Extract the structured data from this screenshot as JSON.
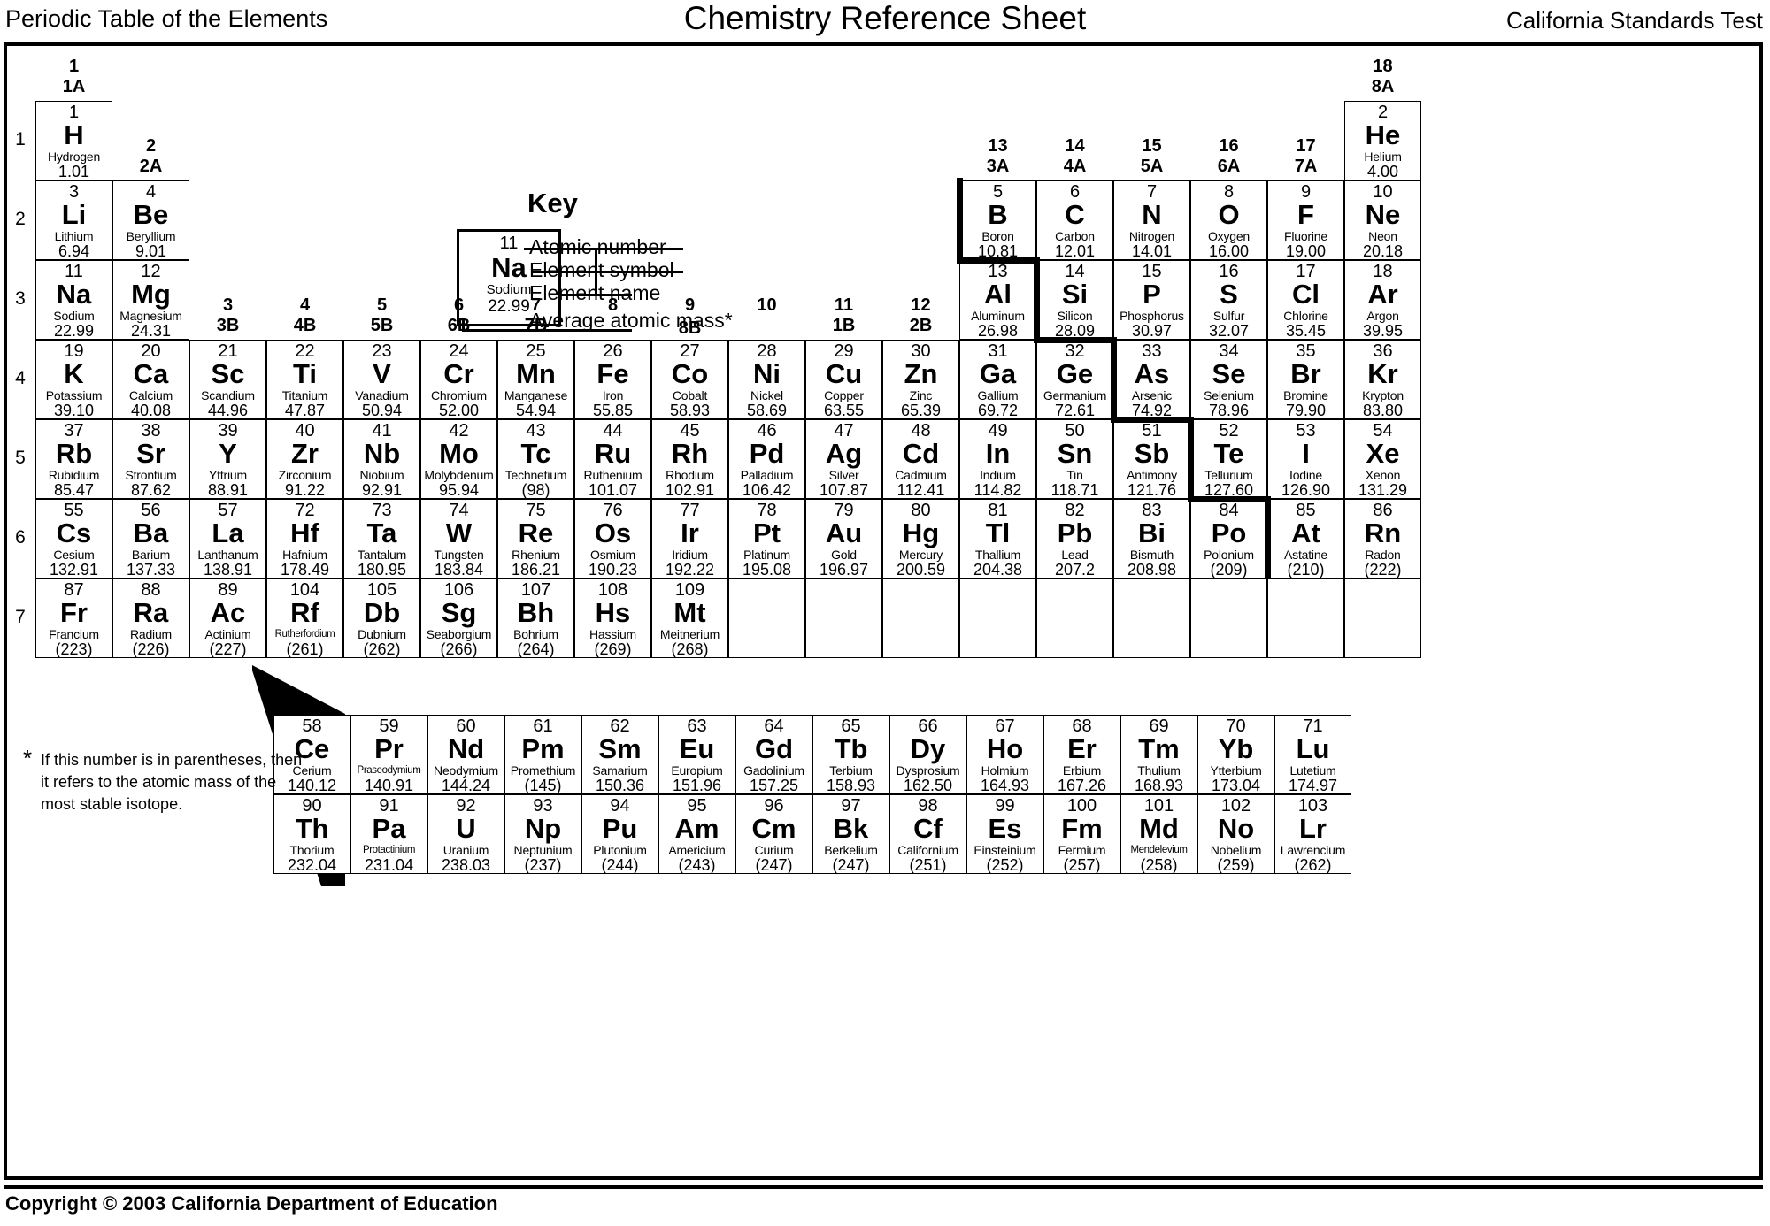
{
  "header": {
    "left": "Periodic Table of the Elements",
    "center": "Chemistry Reference Sheet",
    "right": "California Standards Test"
  },
  "key": {
    "title": "Key",
    "sample": {
      "number": "11",
      "symbol": "Na",
      "name": "Sodium",
      "mass": "22.99"
    },
    "labels": {
      "atomic_number": "Atomic number",
      "element_symbol": "Element symbol",
      "element_name": "Element name",
      "average_atomic_mass": "Average atomic mass*"
    }
  },
  "footnote": {
    "star": "*",
    "line1": "If this number is in parentheses, then",
    "line2": "it refers to the atomic mass of the",
    "line3": "most stable isotope."
  },
  "copyright": "Copyright © 2003 California Department of Education",
  "periods": [
    "1",
    "2",
    "3",
    "4",
    "5",
    "6",
    "7"
  ],
  "groups": [
    {
      "col": 1,
      "num": "1",
      "roman": "1A"
    },
    {
      "col": 2,
      "num": "2",
      "roman": "2A"
    },
    {
      "col": 3,
      "num": "3",
      "roman": "3B"
    },
    {
      "col": 4,
      "num": "4",
      "roman": "4B"
    },
    {
      "col": 5,
      "num": "5",
      "roman": "5B"
    },
    {
      "col": 6,
      "num": "6",
      "roman": "6B"
    },
    {
      "col": 7,
      "num": "7",
      "roman": "7B"
    },
    {
      "col": 8,
      "num": "8",
      "roman": ""
    },
    {
      "col": 9,
      "num": "9",
      "roman": ""
    },
    {
      "col": 10,
      "num": "10",
      "roman": ""
    },
    {
      "col": 11,
      "num": "11",
      "roman": "1B"
    },
    {
      "col": 12,
      "num": "12",
      "roman": "2B"
    },
    {
      "col": 13,
      "num": "13",
      "roman": "3A"
    },
    {
      "col": 14,
      "num": "14",
      "roman": "4A"
    },
    {
      "col": 15,
      "num": "15",
      "roman": "5A"
    },
    {
      "col": 16,
      "num": "16",
      "roman": "6A"
    },
    {
      "col": 17,
      "num": "17",
      "roman": "7A"
    },
    {
      "col": 18,
      "num": "18",
      "roman": "8A"
    }
  ],
  "group8b_label": "8B",
  "elements": [
    {
      "z": "1",
      "sym": "H",
      "name": "Hydrogen",
      "mass": "1.01",
      "col": 1,
      "row": 1
    },
    {
      "z": "2",
      "sym": "He",
      "name": "Helium",
      "mass": "4.00",
      "col": 18,
      "row": 1
    },
    {
      "z": "3",
      "sym": "Li",
      "name": "Lithium",
      "mass": "6.94",
      "col": 1,
      "row": 2
    },
    {
      "z": "4",
      "sym": "Be",
      "name": "Beryllium",
      "mass": "9.01",
      "col": 2,
      "row": 2
    },
    {
      "z": "5",
      "sym": "B",
      "name": "Boron",
      "mass": "10.81",
      "col": 13,
      "row": 2
    },
    {
      "z": "6",
      "sym": "C",
      "name": "Carbon",
      "mass": "12.01",
      "col": 14,
      "row": 2
    },
    {
      "z": "7",
      "sym": "N",
      "name": "Nitrogen",
      "mass": "14.01",
      "col": 15,
      "row": 2
    },
    {
      "z": "8",
      "sym": "O",
      "name": "Oxygen",
      "mass": "16.00",
      "col": 16,
      "row": 2
    },
    {
      "z": "9",
      "sym": "F",
      "name": "Fluorine",
      "mass": "19.00",
      "col": 17,
      "row": 2
    },
    {
      "z": "10",
      "sym": "Ne",
      "name": "Neon",
      "mass": "20.18",
      "col": 18,
      "row": 2
    },
    {
      "z": "11",
      "sym": "Na",
      "name": "Sodium",
      "mass": "22.99",
      "col": 1,
      "row": 3
    },
    {
      "z": "12",
      "sym": "Mg",
      "name": "Magnesium",
      "mass": "24.31",
      "col": 2,
      "row": 3
    },
    {
      "z": "13",
      "sym": "Al",
      "name": "Aluminum",
      "mass": "26.98",
      "col": 13,
      "row": 3
    },
    {
      "z": "14",
      "sym": "Si",
      "name": "Silicon",
      "mass": "28.09",
      "col": 14,
      "row": 3
    },
    {
      "z": "15",
      "sym": "P",
      "name": "Phosphorus",
      "mass": "30.97",
      "col": 15,
      "row": 3
    },
    {
      "z": "16",
      "sym": "S",
      "name": "Sulfur",
      "mass": "32.07",
      "col": 16,
      "row": 3
    },
    {
      "z": "17",
      "sym": "Cl",
      "name": "Chlorine",
      "mass": "35.45",
      "col": 17,
      "row": 3
    },
    {
      "z": "18",
      "sym": "Ar",
      "name": "Argon",
      "mass": "39.95",
      "col": 18,
      "row": 3
    },
    {
      "z": "19",
      "sym": "K",
      "name": "Potassium",
      "mass": "39.10",
      "col": 1,
      "row": 4
    },
    {
      "z": "20",
      "sym": "Ca",
      "name": "Calcium",
      "mass": "40.08",
      "col": 2,
      "row": 4
    },
    {
      "z": "21",
      "sym": "Sc",
      "name": "Scandium",
      "mass": "44.96",
      "col": 3,
      "row": 4
    },
    {
      "z": "22",
      "sym": "Ti",
      "name": "Titanium",
      "mass": "47.87",
      "col": 4,
      "row": 4
    },
    {
      "z": "23",
      "sym": "V",
      "name": "Vanadium",
      "mass": "50.94",
      "col": 5,
      "row": 4
    },
    {
      "z": "24",
      "sym": "Cr",
      "name": "Chromium",
      "mass": "52.00",
      "col": 6,
      "row": 4
    },
    {
      "z": "25",
      "sym": "Mn",
      "name": "Manganese",
      "mass": "54.94",
      "col": 7,
      "row": 4
    },
    {
      "z": "26",
      "sym": "Fe",
      "name": "Iron",
      "mass": "55.85",
      "col": 8,
      "row": 4
    },
    {
      "z": "27",
      "sym": "Co",
      "name": "Cobalt",
      "mass": "58.93",
      "col": 9,
      "row": 4
    },
    {
      "z": "28",
      "sym": "Ni",
      "name": "Nickel",
      "mass": "58.69",
      "col": 10,
      "row": 4
    },
    {
      "z": "29",
      "sym": "Cu",
      "name": "Copper",
      "mass": "63.55",
      "col": 11,
      "row": 4
    },
    {
      "z": "30",
      "sym": "Zn",
      "name": "Zinc",
      "mass": "65.39",
      "col": 12,
      "row": 4
    },
    {
      "z": "31",
      "sym": "Ga",
      "name": "Gallium",
      "mass": "69.72",
      "col": 13,
      "row": 4
    },
    {
      "z": "32",
      "sym": "Ge",
      "name": "Germanium",
      "mass": "72.61",
      "col": 14,
      "row": 4
    },
    {
      "z": "33",
      "sym": "As",
      "name": "Arsenic",
      "mass": "74.92",
      "col": 15,
      "row": 4
    },
    {
      "z": "34",
      "sym": "Se",
      "name": "Selenium",
      "mass": "78.96",
      "col": 16,
      "row": 4
    },
    {
      "z": "35",
      "sym": "Br",
      "name": "Bromine",
      "mass": "79.90",
      "col": 17,
      "row": 4
    },
    {
      "z": "36",
      "sym": "Kr",
      "name": "Krypton",
      "mass": "83.80",
      "col": 18,
      "row": 4
    },
    {
      "z": "37",
      "sym": "Rb",
      "name": "Rubidium",
      "mass": "85.47",
      "col": 1,
      "row": 5
    },
    {
      "z": "38",
      "sym": "Sr",
      "name": "Strontium",
      "mass": "87.62",
      "col": 2,
      "row": 5
    },
    {
      "z": "39",
      "sym": "Y",
      "name": "Yttrium",
      "mass": "88.91",
      "col": 3,
      "row": 5
    },
    {
      "z": "40",
      "sym": "Zr",
      "name": "Zirconium",
      "mass": "91.22",
      "col": 4,
      "row": 5
    },
    {
      "z": "41",
      "sym": "Nb",
      "name": "Niobium",
      "mass": "92.91",
      "col": 5,
      "row": 5
    },
    {
      "z": "42",
      "sym": "Mo",
      "name": "Molybdenum",
      "mass": "95.94",
      "col": 6,
      "row": 5
    },
    {
      "z": "43",
      "sym": "Tc",
      "name": "Technetium",
      "mass": "(98)",
      "col": 7,
      "row": 5
    },
    {
      "z": "44",
      "sym": "Ru",
      "name": "Ruthenium",
      "mass": "101.07",
      "col": 8,
      "row": 5
    },
    {
      "z": "45",
      "sym": "Rh",
      "name": "Rhodium",
      "mass": "102.91",
      "col": 9,
      "row": 5
    },
    {
      "z": "46",
      "sym": "Pd",
      "name": "Palladium",
      "mass": "106.42",
      "col": 10,
      "row": 5
    },
    {
      "z": "47",
      "sym": "Ag",
      "name": "Silver",
      "mass": "107.87",
      "col": 11,
      "row": 5
    },
    {
      "z": "48",
      "sym": "Cd",
      "name": "Cadmium",
      "mass": "112.41",
      "col": 12,
      "row": 5
    },
    {
      "z": "49",
      "sym": "In",
      "name": "Indium",
      "mass": "114.82",
      "col": 13,
      "row": 5
    },
    {
      "z": "50",
      "sym": "Sn",
      "name": "Tin",
      "mass": "118.71",
      "col": 14,
      "row": 5
    },
    {
      "z": "51",
      "sym": "Sb",
      "name": "Antimony",
      "mass": "121.76",
      "col": 15,
      "row": 5
    },
    {
      "z": "52",
      "sym": "Te",
      "name": "Tellurium",
      "mass": "127.60",
      "col": 16,
      "row": 5
    },
    {
      "z": "53",
      "sym": "I",
      "name": "Iodine",
      "mass": "126.90",
      "col": 17,
      "row": 5
    },
    {
      "z": "54",
      "sym": "Xe",
      "name": "Xenon",
      "mass": "131.29",
      "col": 18,
      "row": 5
    },
    {
      "z": "55",
      "sym": "Cs",
      "name": "Cesium",
      "mass": "132.91",
      "col": 1,
      "row": 6
    },
    {
      "z": "56",
      "sym": "Ba",
      "name": "Barium",
      "mass": "137.33",
      "col": 2,
      "row": 6
    },
    {
      "z": "57",
      "sym": "La",
      "name": "Lanthanum",
      "mass": "138.91",
      "col": 3,
      "row": 6
    },
    {
      "z": "72",
      "sym": "Hf",
      "name": "Hafnium",
      "mass": "178.49",
      "col": 4,
      "row": 6
    },
    {
      "z": "73",
      "sym": "Ta",
      "name": "Tantalum",
      "mass": "180.95",
      "col": 5,
      "row": 6
    },
    {
      "z": "74",
      "sym": "W",
      "name": "Tungsten",
      "mass": "183.84",
      "col": 6,
      "row": 6
    },
    {
      "z": "75",
      "sym": "Re",
      "name": "Rhenium",
      "mass": "186.21",
      "col": 7,
      "row": 6
    },
    {
      "z": "76",
      "sym": "Os",
      "name": "Osmium",
      "mass": "190.23",
      "col": 8,
      "row": 6
    },
    {
      "z": "77",
      "sym": "Ir",
      "name": "Iridium",
      "mass": "192.22",
      "col": 9,
      "row": 6
    },
    {
      "z": "78",
      "sym": "Pt",
      "name": "Platinum",
      "mass": "195.08",
      "col": 10,
      "row": 6
    },
    {
      "z": "79",
      "sym": "Au",
      "name": "Gold",
      "mass": "196.97",
      "col": 11,
      "row": 6
    },
    {
      "z": "80",
      "sym": "Hg",
      "name": "Mercury",
      "mass": "200.59",
      "col": 12,
      "row": 6
    },
    {
      "z": "81",
      "sym": "Tl",
      "name": "Thallium",
      "mass": "204.38",
      "col": 13,
      "row": 6
    },
    {
      "z": "82",
      "sym": "Pb",
      "name": "Lead",
      "mass": "207.2",
      "col": 14,
      "row": 6
    },
    {
      "z": "83",
      "sym": "Bi",
      "name": "Bismuth",
      "mass": "208.98",
      "col": 15,
      "row": 6
    },
    {
      "z": "84",
      "sym": "Po",
      "name": "Polonium",
      "mass": "(209)",
      "col": 16,
      "row": 6
    },
    {
      "z": "85",
      "sym": "At",
      "name": "Astatine",
      "mass": "(210)",
      "col": 17,
      "row": 6
    },
    {
      "z": "86",
      "sym": "Rn",
      "name": "Radon",
      "mass": "(222)",
      "col": 18,
      "row": 6
    },
    {
      "z": "87",
      "sym": "Fr",
      "name": "Francium",
      "mass": "(223)",
      "col": 1,
      "row": 7
    },
    {
      "z": "88",
      "sym": "Ra",
      "name": "Radium",
      "mass": "(226)",
      "col": 2,
      "row": 7
    },
    {
      "z": "89",
      "sym": "Ac",
      "name": "Actinium",
      "mass": "(227)",
      "col": 3,
      "row": 7
    },
    {
      "z": "104",
      "sym": "Rf",
      "name": "Rutherfordium",
      "mass": "(261)",
      "col": 4,
      "row": 7,
      "tiny": true
    },
    {
      "z": "105",
      "sym": "Db",
      "name": "Dubnium",
      "mass": "(262)",
      "col": 5,
      "row": 7
    },
    {
      "z": "106",
      "sym": "Sg",
      "name": "Seaborgium",
      "mass": "(266)",
      "col": 6,
      "row": 7
    },
    {
      "z": "107",
      "sym": "Bh",
      "name": "Bohrium",
      "mass": "(264)",
      "col": 7,
      "row": 7
    },
    {
      "z": "108",
      "sym": "Hs",
      "name": "Hassium",
      "mass": "(269)",
      "col": 8,
      "row": 7
    },
    {
      "z": "109",
      "sym": "Mt",
      "name": "Meitnerium",
      "mass": "(268)",
      "col": 9,
      "row": 7
    }
  ],
  "empty_cells_row7": [
    10,
    11,
    12,
    13,
    14,
    15,
    16,
    17,
    18
  ],
  "lanthanides": [
    {
      "z": "58",
      "sym": "Ce",
      "name": "Cerium",
      "mass": "140.12"
    },
    {
      "z": "59",
      "sym": "Pr",
      "name": "Praseodymium",
      "mass": "140.91",
      "tiny": true
    },
    {
      "z": "60",
      "sym": "Nd",
      "name": "Neodymium",
      "mass": "144.24"
    },
    {
      "z": "61",
      "sym": "Pm",
      "name": "Promethium",
      "mass": "(145)"
    },
    {
      "z": "62",
      "sym": "Sm",
      "name": "Samarium",
      "mass": "150.36"
    },
    {
      "z": "63",
      "sym": "Eu",
      "name": "Europium",
      "mass": "151.96"
    },
    {
      "z": "64",
      "sym": "Gd",
      "name": "Gadolinium",
      "mass": "157.25"
    },
    {
      "z": "65",
      "sym": "Tb",
      "name": "Terbium",
      "mass": "158.93"
    },
    {
      "z": "66",
      "sym": "Dy",
      "name": "Dysprosium",
      "mass": "162.50"
    },
    {
      "z": "67",
      "sym": "Ho",
      "name": "Holmium",
      "mass": "164.93"
    },
    {
      "z": "68",
      "sym": "Er",
      "name": "Erbium",
      "mass": "167.26"
    },
    {
      "z": "69",
      "sym": "Tm",
      "name": "Thulium",
      "mass": "168.93"
    },
    {
      "z": "70",
      "sym": "Yb",
      "name": "Ytterbium",
      "mass": "173.04"
    },
    {
      "z": "71",
      "sym": "Lu",
      "name": "Lutetium",
      "mass": "174.97"
    }
  ],
  "actinides": [
    {
      "z": "90",
      "sym": "Th",
      "name": "Thorium",
      "mass": "232.04"
    },
    {
      "z": "91",
      "sym": "Pa",
      "name": "Protactinium",
      "mass": "231.04",
      "tiny": true
    },
    {
      "z": "92",
      "sym": "U",
      "name": "Uranium",
      "mass": "238.03"
    },
    {
      "z": "93",
      "sym": "Np",
      "name": "Neptunium",
      "mass": "(237)"
    },
    {
      "z": "94",
      "sym": "Pu",
      "name": "Plutonium",
      "mass": "(244)"
    },
    {
      "z": "95",
      "sym": "Am",
      "name": "Americium",
      "mass": "(243)"
    },
    {
      "z": "96",
      "sym": "Cm",
      "name": "Curium",
      "mass": "(247)"
    },
    {
      "z": "97",
      "sym": "Bk",
      "name": "Berkelium",
      "mass": "(247)"
    },
    {
      "z": "98",
      "sym": "Cf",
      "name": "Californium",
      "mass": "(251)"
    },
    {
      "z": "99",
      "sym": "Es",
      "name": "Einsteinium",
      "mass": "(252)"
    },
    {
      "z": "100",
      "sym": "Fm",
      "name": "Fermium",
      "mass": "(257)"
    },
    {
      "z": "101",
      "sym": "Md",
      "name": "Mendelevium",
      "mass": "(258)",
      "tiny": true
    },
    {
      "z": "102",
      "sym": "No",
      "name": "Nobelium",
      "mass": "(259)"
    },
    {
      "z": "103",
      "sym": "Lr",
      "name": "Lawrencium",
      "mass": "(262)"
    }
  ]
}
